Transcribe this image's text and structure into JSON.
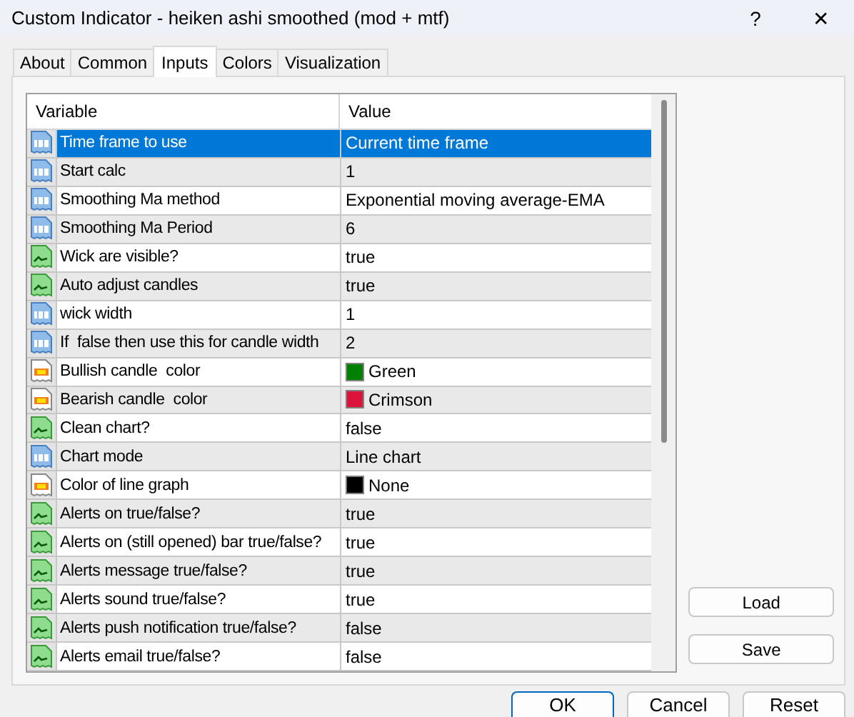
{
  "window": {
    "title": "Custom Indicator - heiken ashi smoothed (mod + mtf)",
    "help": "?",
    "close": "✕"
  },
  "tabs": [
    {
      "label": "About",
      "selected": false
    },
    {
      "label": "Common",
      "selected": false
    },
    {
      "label": "Inputs",
      "selected": true
    },
    {
      "label": "Colors",
      "selected": false
    },
    {
      "label": "Visualization",
      "selected": false
    }
  ],
  "grid": {
    "columns": [
      "Variable",
      "Value"
    ],
    "rows": [
      {
        "kind": "number",
        "variable": "Time frame to use",
        "value": "Current time frame",
        "selected": true
      },
      {
        "kind": "number",
        "variable": "Start calc",
        "value": "1",
        "selected": false
      },
      {
        "kind": "number",
        "variable": "Smoothing Ma method",
        "value": "Exponential moving average-EMA",
        "selected": false
      },
      {
        "kind": "number",
        "variable": "Smoothing Ma Period",
        "value": "6",
        "selected": false
      },
      {
        "kind": "bool",
        "variable": "Wick are visible?",
        "value": "true",
        "selected": false
      },
      {
        "kind": "bool",
        "variable": "Auto adjust candles",
        "value": "true",
        "selected": false
      },
      {
        "kind": "number",
        "variable": "wick width",
        "value": "1",
        "selected": false
      },
      {
        "kind": "number",
        "variable": "If  false then use this for candle width",
        "value": "2",
        "selected": false
      },
      {
        "kind": "color",
        "variable": "Bullish candle  color",
        "value": "Green",
        "color": "#008000",
        "selected": false
      },
      {
        "kind": "color",
        "variable": "Bearish candle  color",
        "value": "Crimson",
        "color": "#dc143c",
        "selected": false
      },
      {
        "kind": "bool",
        "variable": "Clean chart?",
        "value": "false",
        "selected": false
      },
      {
        "kind": "number",
        "variable": "Chart mode",
        "value": "Line chart",
        "selected": false
      },
      {
        "kind": "color",
        "variable": "Color of line graph",
        "value": "None",
        "color": "#000000",
        "selected": false
      },
      {
        "kind": "bool",
        "variable": "Alerts on true/false?",
        "value": "true",
        "selected": false
      },
      {
        "kind": "bool",
        "variable": "Alerts on (still opened) bar true/false?",
        "value": "true",
        "selected": false
      },
      {
        "kind": "bool",
        "variable": "Alerts message true/false?",
        "value": "true",
        "selected": false
      },
      {
        "kind": "bool",
        "variable": "Alerts sound true/false?",
        "value": "true",
        "selected": false
      },
      {
        "kind": "bool",
        "variable": "Alerts push notification true/false?",
        "value": "false",
        "selected": false
      },
      {
        "kind": "bool",
        "variable": "Alerts email true/false?",
        "value": "false",
        "selected": false
      }
    ]
  },
  "side_buttons": [
    "Load",
    "Save"
  ],
  "buttons": [
    {
      "label": "OK",
      "default": true
    },
    {
      "label": "Cancel",
      "default": false
    },
    {
      "label": "Reset",
      "default": false
    }
  ]
}
